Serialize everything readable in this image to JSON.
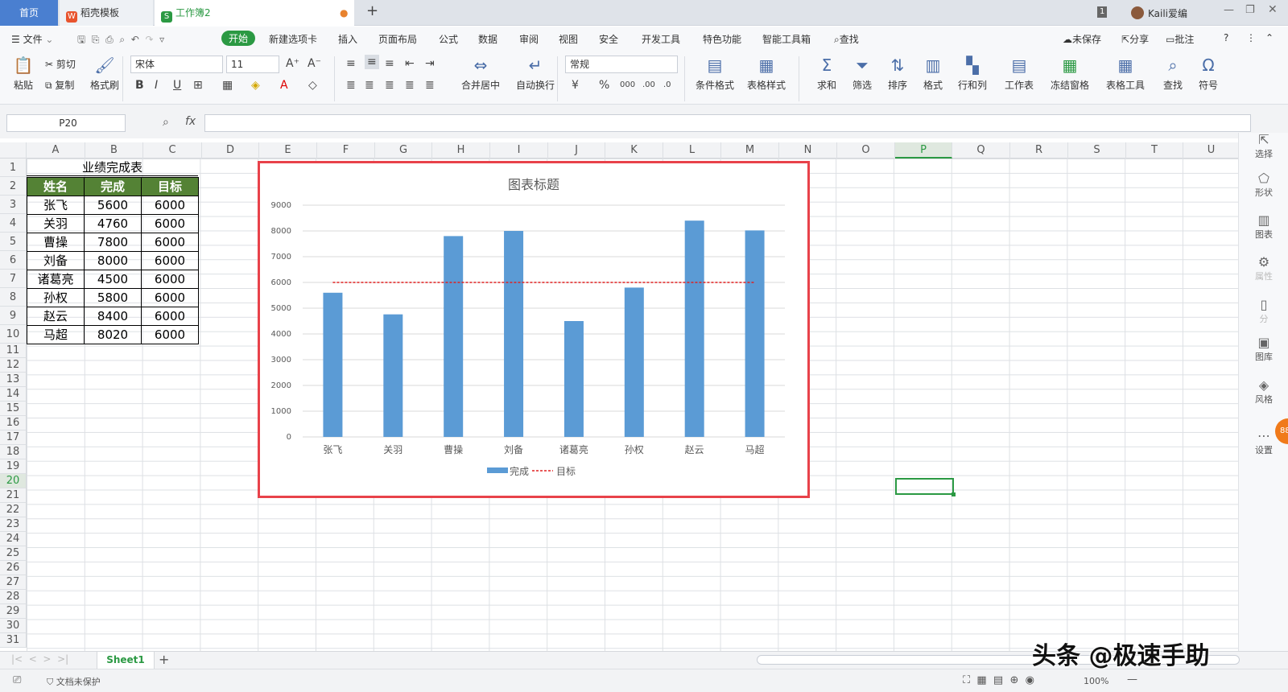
{
  "tabs": {
    "home": "首页",
    "doc_template": "稻壳模板",
    "workbook": "工作簿2",
    "new_tab": "+"
  },
  "window": {
    "page_indicator": "1",
    "user": "Kaili爱编"
  },
  "menu": {
    "file": "文件",
    "start": "开始",
    "items": [
      "新建选项卡",
      "插入",
      "页面布局",
      "公式",
      "数据",
      "审阅",
      "视图",
      "安全",
      "开发工具",
      "特色功能",
      "智能工具箱"
    ],
    "search": "查找",
    "unsaved": "未保存",
    "share": "分享",
    "comment": "批注"
  },
  "ribbon": {
    "paste": "粘贴",
    "cut": "剪切",
    "copy": "复制",
    "format_painter": "格式刷",
    "font_name": "宋体",
    "font_size": "11",
    "merge_center": "合并居中",
    "wrap_text": "自动换行",
    "number_format": "常规",
    "cond_format": "条件格式",
    "table_style": "表格样式",
    "sum": "求和",
    "filter": "筛选",
    "sort": "排序",
    "format": "格式",
    "row_col": "行和列",
    "worksheet": "工作表",
    "freeze": "冻结窗格",
    "table_tools": "表格工具",
    "find": "查找",
    "symbol": "符号"
  },
  "formula_bar": {
    "name_box": "P20",
    "fx": "fx",
    "content": ""
  },
  "columns": [
    "A",
    "B",
    "C",
    "D",
    "E",
    "F",
    "G",
    "H",
    "I",
    "J",
    "K",
    "L",
    "M",
    "N",
    "O",
    "P",
    "Q",
    "R",
    "S",
    "T",
    "U"
  ],
  "rows": [
    "1",
    "2",
    "3",
    "4",
    "5",
    "6",
    "7",
    "8",
    "9",
    "10",
    "11",
    "12",
    "13",
    "14",
    "15",
    "16",
    "17",
    "18",
    "19",
    "20",
    "21",
    "22",
    "23",
    "24",
    "25",
    "26",
    "27",
    "28",
    "29",
    "30",
    "31"
  ],
  "table": {
    "title": "业绩完成表",
    "headers": [
      "姓名",
      "完成",
      "目标"
    ],
    "rows": [
      [
        "张飞",
        "5600",
        "6000"
      ],
      [
        "关羽",
        "4760",
        "6000"
      ],
      [
        "曹操",
        "7800",
        "6000"
      ],
      [
        "刘备",
        "8000",
        "6000"
      ],
      [
        "诸葛亮",
        "4500",
        "6000"
      ],
      [
        "孙权",
        "5800",
        "6000"
      ],
      [
        "赵云",
        "8400",
        "6000"
      ],
      [
        "马超",
        "8020",
        "6000"
      ]
    ]
  },
  "chart_data": {
    "type": "bar",
    "title": "图表标题",
    "categories": [
      "张飞",
      "关羽",
      "曹操",
      "刘备",
      "诸葛亮",
      "孙权",
      "赵云",
      "马超"
    ],
    "series": [
      {
        "name": "完成",
        "type": "bar",
        "values": [
          5600,
          4760,
          7800,
          8000,
          4500,
          5800,
          8400,
          8020
        ],
        "color": "#5b9bd5"
      },
      {
        "name": "目标",
        "type": "line",
        "style": "dashed",
        "values": [
          6000,
          6000,
          6000,
          6000,
          6000,
          6000,
          6000,
          6000
        ],
        "color": "#e02020"
      }
    ],
    "ylim": [
      0,
      9000
    ],
    "yticks": [
      "0",
      "1000",
      "2000",
      "3000",
      "4000",
      "5000",
      "6000",
      "7000",
      "8000",
      "9000"
    ],
    "grid": true,
    "legend": "bottom",
    "xlabel": "",
    "ylabel": ""
  },
  "right_panel": [
    "选择",
    "形状",
    "图表",
    "属性",
    "分",
    "图库",
    "风格",
    "设置"
  ],
  "sheets": {
    "active": "Sheet1",
    "add": "+"
  },
  "status": {
    "protect": "文档未保护",
    "zoom": "100%"
  },
  "watermark": "头条 @极速手助",
  "colors": {
    "accent_green": "#2b9943",
    "header_green": "#548235",
    "chart_bar": "#5b9bd5",
    "target_line": "#e02020",
    "chart_border": "#e8424a",
    "home_tab": "#4a7fd0"
  }
}
